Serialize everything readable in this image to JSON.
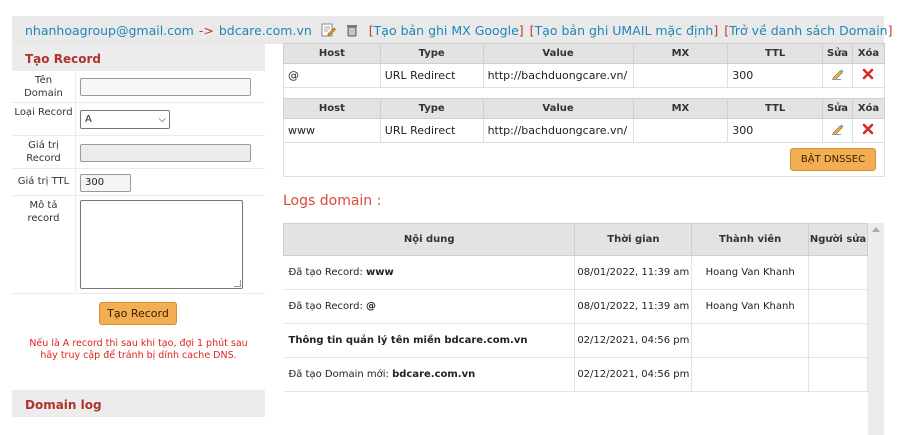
{
  "topbar": {
    "email": "nhanhoagroup@gmail.com",
    "arrow": "->",
    "domain": "bdcare.com.vn",
    "edit_icon": "edit-icon",
    "trash_icon": "trash-icon",
    "link_mx": "Tạo bản ghi MX Google",
    "link_umail": "Tạo bản ghi UMAIL mặc định",
    "link_back": "Trở về danh sách Domain"
  },
  "create_form": {
    "title": "Tạo Record",
    "labels": {
      "domain": "Tên Domain",
      "type": "Loại Record",
      "value": "Giá trị Record",
      "ttl": "Giá trị TTL",
      "desc": "Mô tả record"
    },
    "type_selected": "A",
    "ttl_value": "300",
    "submit_label": "Tạo Record",
    "note": "Nếu là A record thì sau khi tạo, đợi 1 phút sau hãy truy cập để tránh bị dính cache DNS."
  },
  "records": {
    "headers": [
      "Host",
      "Type",
      "Value",
      "MX",
      "TTL",
      "Sửa",
      "Xóa"
    ],
    "rows": [
      {
        "host": "@",
        "type": "URL Redirect",
        "value": "http://bachduongcare.vn/",
        "mx": "",
        "ttl": "300"
      },
      {
        "host": "www",
        "type": "URL Redirect",
        "value": "http://bachduongcare.vn/",
        "mx": "",
        "ttl": "300"
      }
    ],
    "dnssec_label": "BẬT DNSSEC"
  },
  "logs": {
    "title": "Logs domain :",
    "headers": {
      "content": "Nội dung",
      "time": "Thời gian",
      "member": "Thành viên",
      "editor": "Người sửa"
    },
    "rows": [
      {
        "prefix": "Đã tạo Record: ",
        "bold": "www",
        "time": "08/01/2022, 11:39 am",
        "member": "Hoang Van Khanh"
      },
      {
        "prefix": "Đã tạo Record: ",
        "bold": "@",
        "time": "08/01/2022, 11:39 am",
        "member": "Hoang Van Khanh"
      },
      {
        "prefix": "",
        "bold": "Thông tin quản lý tên miền bdcare.com.vn",
        "time": "02/12/2021, 04:56 pm",
        "member": ""
      },
      {
        "prefix": "Đã tạo Domain mới: ",
        "bold": "bdcare.com.vn",
        "time": "02/12/2021, 04:56 pm",
        "member": ""
      }
    ]
  },
  "domain_log": {
    "title": "Domain log"
  },
  "colors": {
    "accent_blue": "#1f87b8",
    "accent_red": "#c0392b",
    "button_orange": "#f3ad52"
  }
}
